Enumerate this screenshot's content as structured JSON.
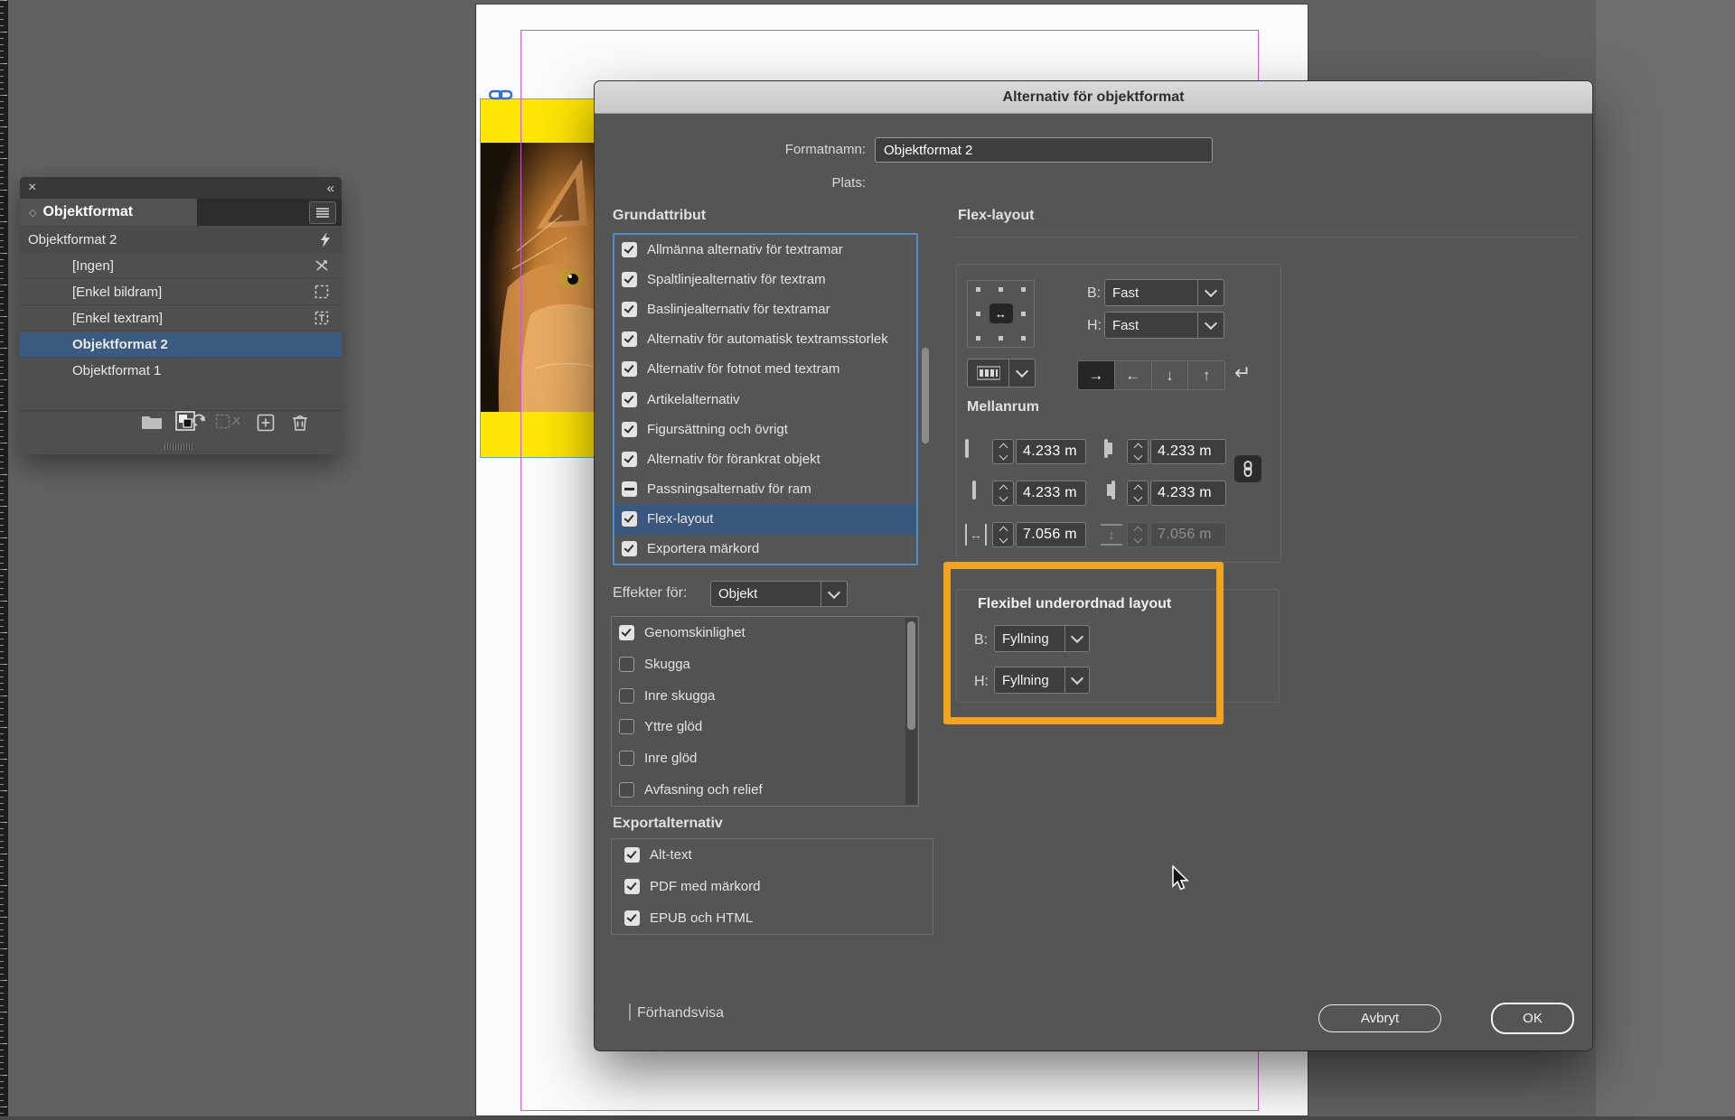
{
  "panel": {
    "close_icon": "×",
    "collapse_icon": "«",
    "tab_marker": "◇",
    "tab_label": "Objektformat",
    "current_style": "Objektformat 2",
    "items": [
      {
        "label": "[Ingen]"
      },
      {
        "label": "[Enkel bildram]"
      },
      {
        "label": "[Enkel textram]"
      },
      {
        "label": "Objektformat 2"
      },
      {
        "label": "Objektformat 1"
      }
    ]
  },
  "dialog": {
    "title": "Alternativ för objektformat",
    "name_label": "Formatnamn:",
    "name_value": "Objektformat 2",
    "location_label": "Plats:",
    "basic": {
      "header": "Grundattribut",
      "items": [
        {
          "label": "Allmänna alternativ för textramar",
          "state": "checked"
        },
        {
          "label": "Spaltlinjealternativ för textram",
          "state": "checked"
        },
        {
          "label": "Baslinjealternativ för textramar",
          "state": "checked"
        },
        {
          "label": "Alternativ för automatisk textramsstorlek",
          "state": "checked"
        },
        {
          "label": "Alternativ för fotnot med textram",
          "state": "checked"
        },
        {
          "label": "Artikelalternativ",
          "state": "checked"
        },
        {
          "label": "Figursättning och övrigt",
          "state": "checked"
        },
        {
          "label": "Alternativ för förankrat objekt",
          "state": "checked"
        },
        {
          "label": "Passningsalternativ för ram",
          "state": "mixed"
        },
        {
          "label": "Flex-layout",
          "state": "checked",
          "selected": true
        },
        {
          "label": "Exportera märkord",
          "state": "checked"
        }
      ]
    },
    "effects": {
      "label": "Effekter för:",
      "target": "Objekt",
      "items": [
        {
          "label": "Genomskinlighet",
          "state": "checked"
        },
        {
          "label": "Skugga",
          "state": "unchecked"
        },
        {
          "label": "Inre skugga",
          "state": "unchecked"
        },
        {
          "label": "Yttre glöd",
          "state": "unchecked"
        },
        {
          "label": "Inre glöd",
          "state": "unchecked"
        },
        {
          "label": "Avfasning och relief",
          "state": "unchecked"
        }
      ]
    },
    "export": {
      "header": "Exportalternativ",
      "items": [
        {
          "label": "Alt-text",
          "state": "checked"
        },
        {
          "label": "PDF med märkord",
          "state": "checked"
        },
        {
          "label": "EPUB och HTML",
          "state": "checked"
        }
      ]
    },
    "flex": {
      "header": "Flex-layout",
      "b_label": "B:",
      "b_value": "Fast",
      "h_label": "H:",
      "h_value": "Fast",
      "center_arrow": "↔",
      "return_arrow": "↵",
      "spacing_header": "Mellanrum",
      "top_value": "4.233 m",
      "left_value": "4.233 m",
      "bottom_value": "4.233 m",
      "right_value": "4.233 m",
      "width_value": "7.056 m",
      "height_value": "7.056 m",
      "width_glyph": "↔",
      "height_glyph": "↕",
      "child_header": "Flexibel underordnad layout",
      "child_b_label": "B:",
      "child_b_value": "Fyllning",
      "child_h_label": "H:",
      "child_h_value": "Fyllning"
    },
    "preview_label": "Förhandsvisa",
    "cancel_label": "Avbryt",
    "ok_label": "OK"
  },
  "colors": {
    "highlight_orange": "#f0a41f",
    "selection_blue": "#3c5b80",
    "list_border_blue": "#4d8fc9",
    "frame_yellow": "#ffe605",
    "guide_magenta": "#c95fd1",
    "link_blue": "#2f6fd6"
  }
}
